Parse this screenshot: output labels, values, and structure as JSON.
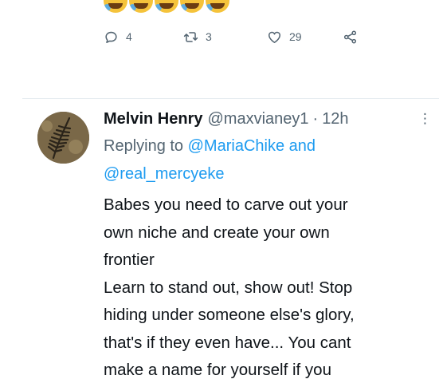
{
  "emojis": {
    "icon": "rolling-on-the-floor-laughing",
    "count": 5
  },
  "actions": {
    "reply_count": "4",
    "retweet_count": "3",
    "like_count": "29"
  },
  "tweet": {
    "display_name": "Melvin Henry",
    "handle": "@maxvianey1",
    "separator": "·",
    "time": "12h",
    "replying_prefix": "Replying to ",
    "reply_to_1": "@MariaChike",
    "replying_conjunction": " and",
    "reply_to_2": "@real_mercyeke",
    "text": "Babes you need to carve out your\nown niche and create your own\nfrontier\nLearn to stand out, show out! Stop\nhiding under someone else's glory,\nthat's if  they even have... You cant\nmake a name for yourself if you"
  },
  "colors": {
    "link": "#1d9bf0",
    "muted": "#536471",
    "text": "#0f1419"
  }
}
